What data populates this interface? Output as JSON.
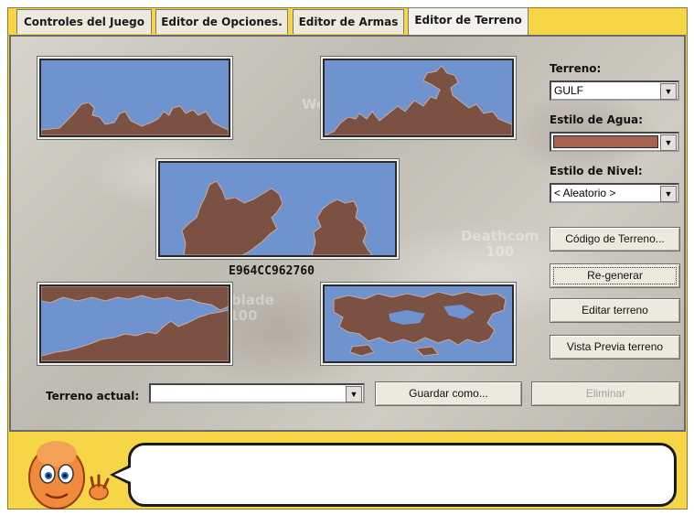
{
  "tabs": [
    {
      "label": "Controles del Juego"
    },
    {
      "label": "Editor de Opciones."
    },
    {
      "label": "Editor de Armas"
    },
    {
      "label": "Editor de Terreno"
    }
  ],
  "active_tab": "Editor de Terreno",
  "background_text": {
    "w": "We",
    "deathcom": "Deathcom",
    "deathcom_hp": "100",
    "apblade": "apblade",
    "apblade_hp": "100"
  },
  "terrain_code": "E964CC962760",
  "sidebar": {
    "terreno_label": "Terreno:",
    "terreno_value": "GULF",
    "agua_label": "Estilo de Agua:",
    "agua_color": "#a56450",
    "nivel_label": "Estilo de Nivel:",
    "nivel_value": "< Aleatorio >",
    "btn_codigo": "Código de Terreno...",
    "btn_regenerar": "Re-generar",
    "btn_editar": "Editar terreno",
    "btn_vista": "Vista Previa terreno"
  },
  "bottom": {
    "terreno_actual_label": "Terreno actual:",
    "terreno_actual_value": "",
    "btn_guardar": "Guardar como...",
    "btn_eliminar": "Eliminar"
  },
  "colors": {
    "sky": "#6f93cf",
    "land": "#7a5142",
    "frame": "#f6d646"
  },
  "icons": {
    "mascot": "worm-mascot-icon",
    "dropdown": "chevron-down-icon"
  },
  "message_bubble": ""
}
